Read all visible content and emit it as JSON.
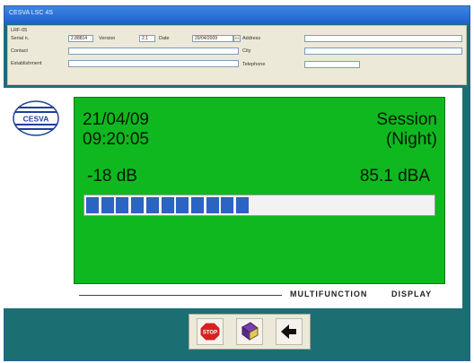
{
  "window": {
    "title": "CESVA LSC 4S"
  },
  "form": {
    "group_label": "LRF-05",
    "serial_label": "Serial n.",
    "serial_value": "2.88814",
    "version_label": "Version",
    "version_value": "2.1",
    "date_label": "Date",
    "date_value": "20/04/2009",
    "date_picker_glyph": "...",
    "contact_label": "Contact",
    "establishment_label": "Establishment",
    "address_label": "Address",
    "city_label": "City",
    "telephone_label": "Telephone"
  },
  "display": {
    "date": "21/04/09",
    "time": "09:20:05",
    "mode_line1": "Session",
    "mode_line2": "(Night)",
    "level_offset": "-18 dB",
    "level_value": "85.1 dBA",
    "bar_segments_filled": 11,
    "bar_fill_fraction": 0.47,
    "footer_left": "MULTIFUNCTION",
    "footer_right": "DISPLAY"
  },
  "logo": {
    "text": "CESVA"
  },
  "toolbar": {
    "stop_label": "STOP",
    "icons": [
      "stop-icon",
      "book-icon",
      "back-arrow-icon"
    ]
  },
  "colors": {
    "display_background": "#0fb81f",
    "bar_fill": "#2d63c2",
    "window_background": "#1b6f73"
  }
}
